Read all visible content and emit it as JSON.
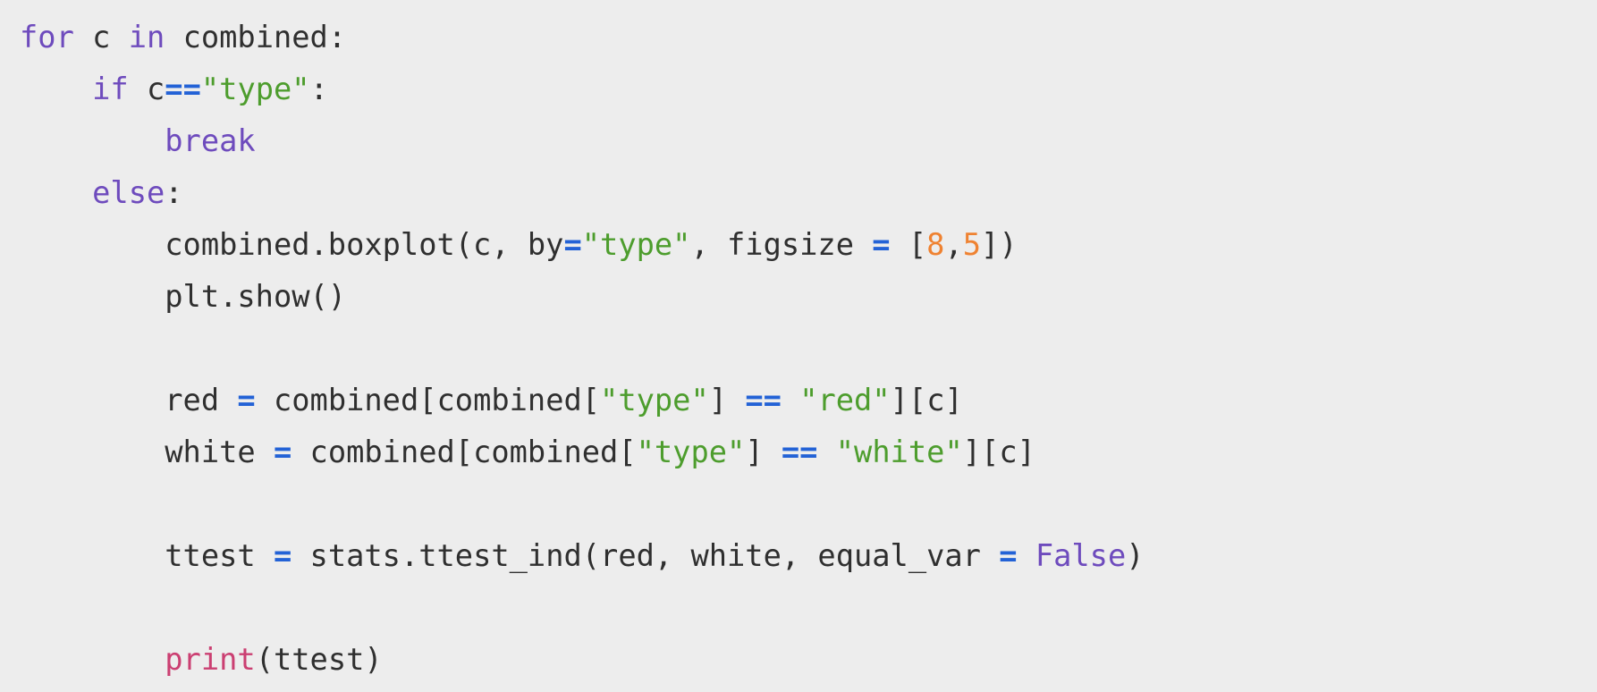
{
  "colors": {
    "background": "#ededed",
    "text": "#2f2f2f",
    "keyword": "#6e4bbd",
    "string": "#4d9d2d",
    "operator": "#2362d6",
    "number": "#ef8231",
    "builtin": "#cb3f72"
  },
  "code": {
    "lines": [
      [
        {
          "t": "keyword",
          "v": "for"
        },
        {
          "t": "plain",
          "v": " c "
        },
        {
          "t": "keyword",
          "v": "in"
        },
        {
          "t": "plain",
          "v": " combined:"
        }
      ],
      [
        {
          "t": "plain",
          "v": "    "
        },
        {
          "t": "keyword",
          "v": "if"
        },
        {
          "t": "plain",
          "v": " c"
        },
        {
          "t": "operator",
          "v": "=="
        },
        {
          "t": "string",
          "v": "\"type\""
        },
        {
          "t": "plain",
          "v": ":"
        }
      ],
      [
        {
          "t": "plain",
          "v": "        "
        },
        {
          "t": "keyword",
          "v": "break"
        }
      ],
      [
        {
          "t": "plain",
          "v": "    "
        },
        {
          "t": "keyword",
          "v": "else"
        },
        {
          "t": "plain",
          "v": ":"
        }
      ],
      [
        {
          "t": "plain",
          "v": "        combined.boxplot(c, by"
        },
        {
          "t": "operator",
          "v": "="
        },
        {
          "t": "string",
          "v": "\"type\""
        },
        {
          "t": "plain",
          "v": ", figsize "
        },
        {
          "t": "operator",
          "v": "="
        },
        {
          "t": "plain",
          "v": " ["
        },
        {
          "t": "number",
          "v": "8"
        },
        {
          "t": "plain",
          "v": ","
        },
        {
          "t": "number",
          "v": "5"
        },
        {
          "t": "plain",
          "v": "])"
        }
      ],
      [
        {
          "t": "plain",
          "v": "        plt.show()"
        }
      ],
      [],
      [
        {
          "t": "plain",
          "v": "        red "
        },
        {
          "t": "operator",
          "v": "="
        },
        {
          "t": "plain",
          "v": " combined[combined["
        },
        {
          "t": "string",
          "v": "\"type\""
        },
        {
          "t": "plain",
          "v": "] "
        },
        {
          "t": "operator",
          "v": "=="
        },
        {
          "t": "plain",
          "v": " "
        },
        {
          "t": "string",
          "v": "\"red\""
        },
        {
          "t": "plain",
          "v": "][c]"
        }
      ],
      [
        {
          "t": "plain",
          "v": "        white "
        },
        {
          "t": "operator",
          "v": "="
        },
        {
          "t": "plain",
          "v": " combined[combined["
        },
        {
          "t": "string",
          "v": "\"type\""
        },
        {
          "t": "plain",
          "v": "] "
        },
        {
          "t": "operator",
          "v": "=="
        },
        {
          "t": "plain",
          "v": " "
        },
        {
          "t": "string",
          "v": "\"white\""
        },
        {
          "t": "plain",
          "v": "][c]"
        }
      ],
      [],
      [
        {
          "t": "plain",
          "v": "        ttest "
        },
        {
          "t": "operator",
          "v": "="
        },
        {
          "t": "plain",
          "v": " stats.ttest_ind(red, white, equal_var "
        },
        {
          "t": "operator",
          "v": "="
        },
        {
          "t": "plain",
          "v": " "
        },
        {
          "t": "keyword",
          "v": "False"
        },
        {
          "t": "plain",
          "v": ")"
        }
      ],
      [],
      [
        {
          "t": "plain",
          "v": "        "
        },
        {
          "t": "builtin",
          "v": "print"
        },
        {
          "t": "plain",
          "v": "(ttest)"
        }
      ]
    ]
  }
}
